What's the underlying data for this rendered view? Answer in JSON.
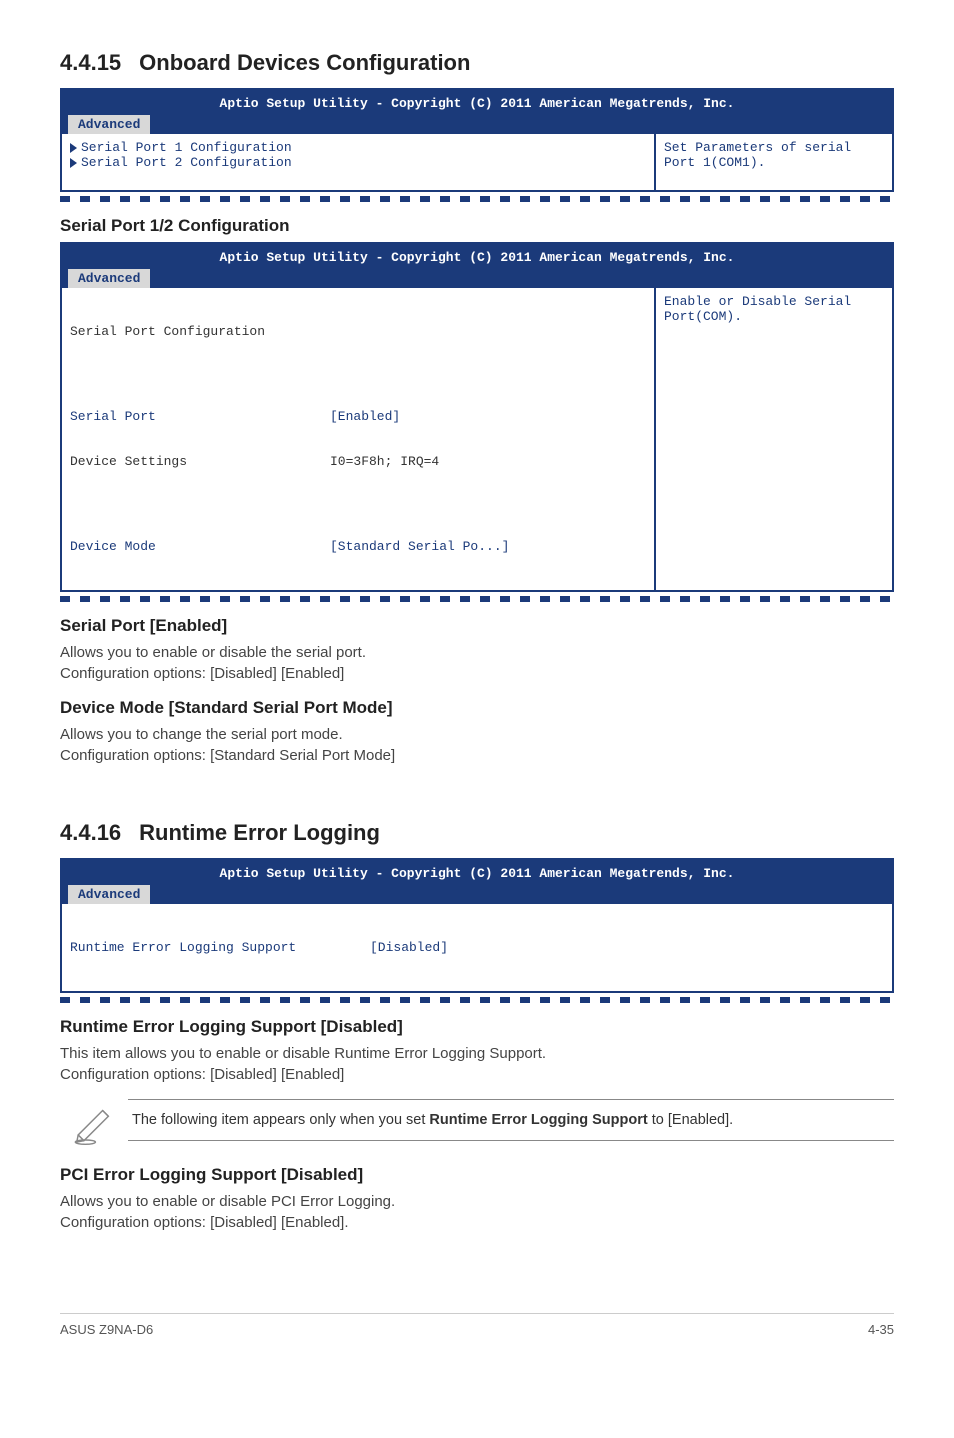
{
  "s1": {
    "num": "4.4.15",
    "title": "Onboard Devices Configuration",
    "bios_title": "Aptio Setup Utility - Copyright (C) 2011 American Megatrends, Inc.",
    "tab": "Advanced",
    "left_line1": "Serial Port 1 Configuration",
    "left_line2": "Serial Port 2 Configuration",
    "help": "Set Parameters of serial Port 1(COM1)."
  },
  "sp12": {
    "heading": "Serial Port 1/2 Configuration",
    "bios_title": "Aptio Setup Utility - Copyright (C) 2011 American Megatrends, Inc.",
    "tab": "Advanced",
    "row0": "Serial Port Configuration",
    "r1_label": "Serial Port",
    "r1_value": "[Enabled]",
    "r2_label": "Device Settings",
    "r2_value": "I0=3F8h; IRQ=4",
    "r3_label": "Device Mode",
    "r3_value": "[Standard Serial Po...]",
    "help": "Enable or Disable Serial Port(COM)."
  },
  "sp_en": {
    "heading": "Serial Port [Enabled]",
    "p1": "Allows you to enable or disable the serial port.",
    "p2": "Configuration options: [Disabled] [Enabled]"
  },
  "dm": {
    "heading": "Device Mode [Standard Serial Port Mode]",
    "p1": "Allows you to change the serial port mode.",
    "p2": "Configuration options: [Standard Serial Port Mode]"
  },
  "s2": {
    "num": "4.4.16",
    "title": "Runtime Error Logging",
    "bios_title": "Aptio Setup Utility - Copyright (C) 2011 American Megatrends, Inc.",
    "tab": "Advanced",
    "r1_label": "Runtime Error Logging Support",
    "r1_value": "[Disabled]"
  },
  "rels": {
    "heading": "Runtime Error Logging Support [Disabled]",
    "p1": "This item allows you to enable or disable Runtime Error Logging Support.",
    "p2": "Configuration options: [Disabled] [Enabled]"
  },
  "note": {
    "pre": "The following item appears only when you set ",
    "bold": "Runtime Error Logging Support",
    "post": " to [Enabled]."
  },
  "pci": {
    "heading": "PCI Error Logging Support [Disabled]",
    "p1": "Allows you to enable or disable PCI Error Logging.",
    "p2": "Configuration options: [Disabled] [Enabled]."
  },
  "footer": {
    "left": "ASUS Z9NA-D6",
    "right": "4-35"
  }
}
